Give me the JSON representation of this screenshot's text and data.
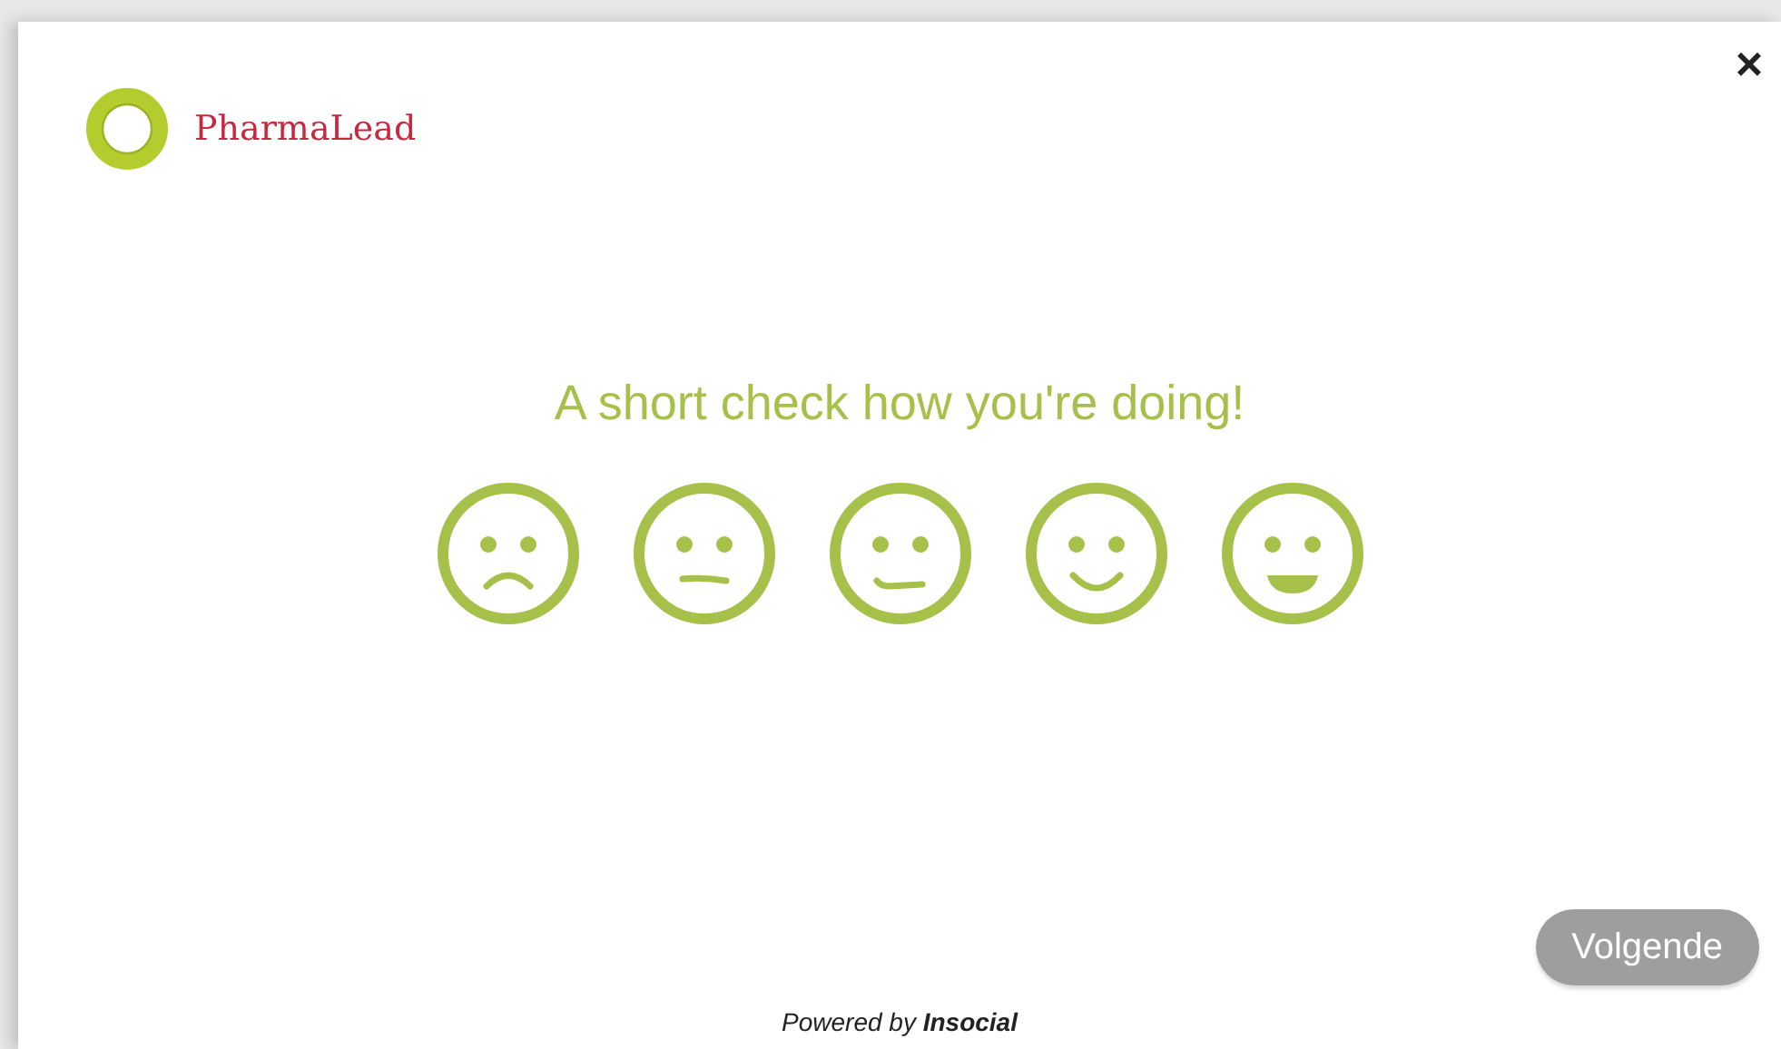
{
  "logo": {
    "name": "PharmaLead"
  },
  "close": "×",
  "question": "A short check how you're doing!",
  "faces": [
    {
      "kind": "sad",
      "selected": false
    },
    {
      "kind": "neutral",
      "selected": false
    },
    {
      "kind": "slight",
      "selected": false
    },
    {
      "kind": "smile",
      "selected": false
    },
    {
      "kind": "grin",
      "selected": false
    }
  ],
  "next_button": {
    "label": "Volgende",
    "disabled": true
  },
  "footer": "Powered by **Insocial**"
}
